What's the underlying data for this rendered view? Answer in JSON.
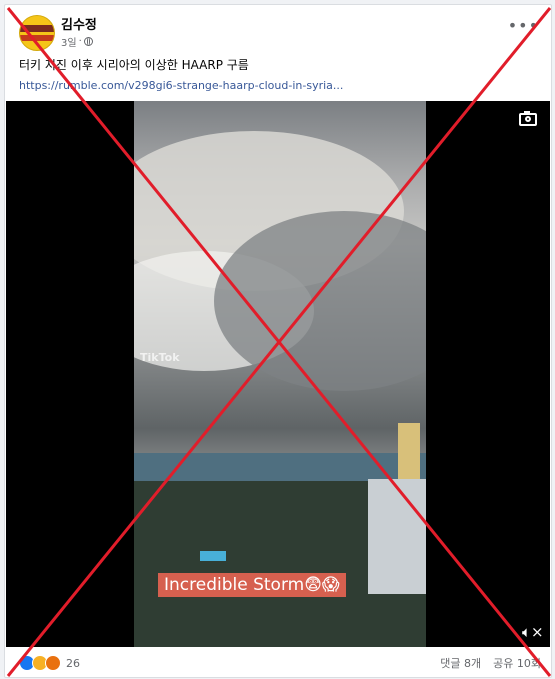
{
  "post": {
    "author": "김수정",
    "time": "3일",
    "text": "터키 지진 이후 시리아의 이상한 HAARP 구름",
    "link": "https://rumble.com/v298gi6-strange-haarp-cloud-in-syria..."
  },
  "video": {
    "watermark": "TikTok",
    "caption": "Incredible Storm😨😱"
  },
  "footer": {
    "reaction_count": "26",
    "comments": "댓글 8개",
    "shares": "공유 10회"
  },
  "overlay": {
    "x_color": "#e11d2a"
  },
  "icons": [
    "globe-icon",
    "more-options-icon",
    "camera-icon",
    "mute-icon",
    "like-reaction-icon",
    "wow-reaction-icon",
    "angry-reaction-icon"
  ]
}
